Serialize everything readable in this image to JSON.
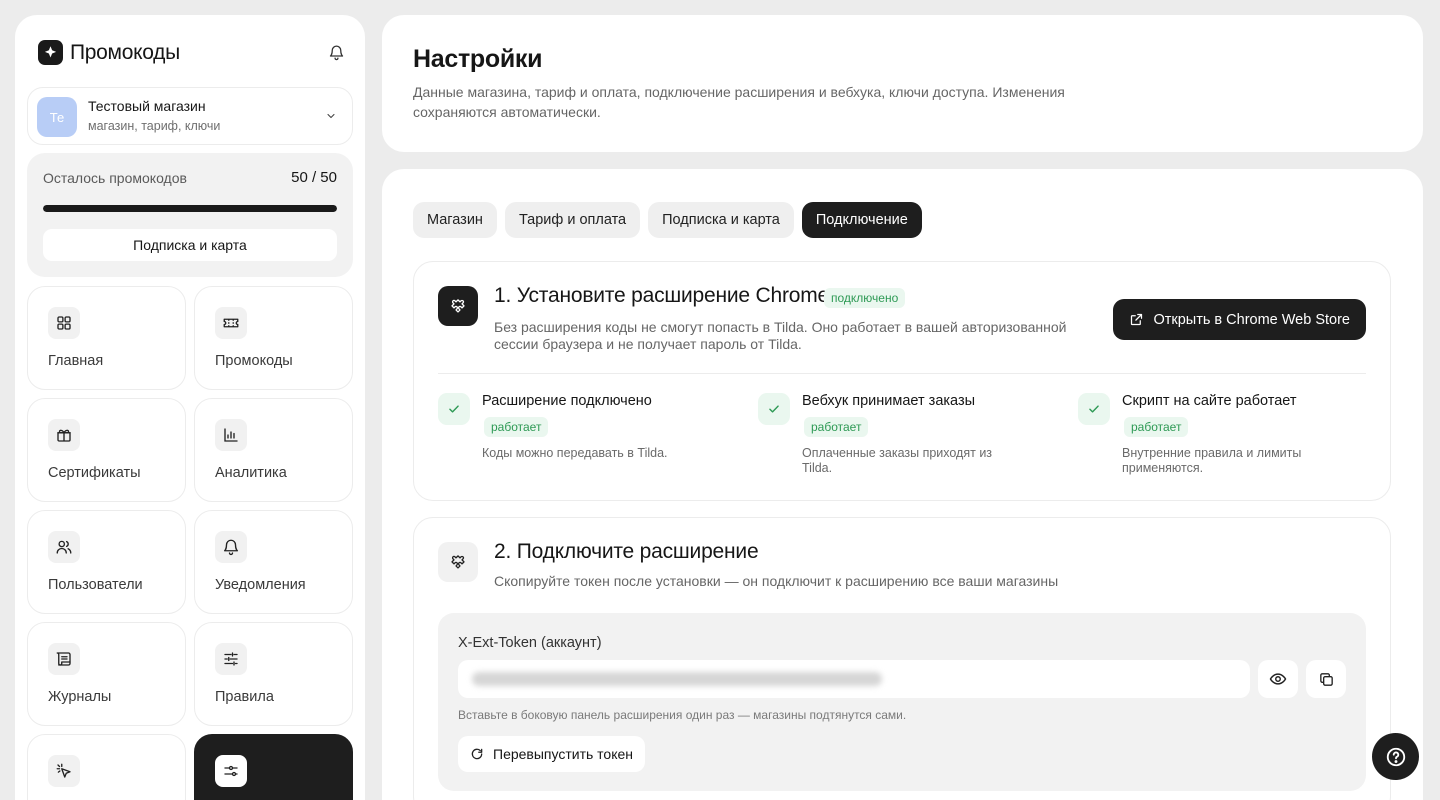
{
  "app": {
    "brand": "Промокоды"
  },
  "store": {
    "avatar": "Те",
    "name": "Тестовый магазин",
    "subtitle": "магазин, тариф, ключи"
  },
  "quota": {
    "label": "Осталось промокодов",
    "value": "50 / 50",
    "progress": 1.0,
    "button": "Подписка и карта"
  },
  "nav": [
    {
      "label": "Главная",
      "icon": "grid-icon"
    },
    {
      "label": "Промокоды",
      "icon": "ticket-icon"
    },
    {
      "label": "Сертификаты",
      "icon": "gift-icon"
    },
    {
      "label": "Аналитика",
      "icon": "bar-chart-icon"
    },
    {
      "label": "Пользователи",
      "icon": "users-icon"
    },
    {
      "label": "Уведомления",
      "icon": "bell-icon"
    },
    {
      "label": "Журналы",
      "icon": "scroll-icon"
    },
    {
      "label": "Правила",
      "icon": "sliders-icon"
    },
    {
      "label": "",
      "icon": "sparkle-icon"
    },
    {
      "label": "",
      "icon": "settings-sliders-icon",
      "active": true
    }
  ],
  "header": {
    "title": "Настройки",
    "description": "Данные магазина, тариф и оплата, подключение расширения и вебхука, ключи доступа. Изменения сохраняются автоматически."
  },
  "tabs": [
    {
      "label": "Магазин",
      "active": false
    },
    {
      "label": "Тариф и оплата",
      "active": false
    },
    {
      "label": "Подписка и карта",
      "active": false
    },
    {
      "label": "Подключение",
      "active": true
    }
  ],
  "step1": {
    "title": "1. Установите расширение Chrome",
    "badge": "подключено",
    "description": "Без расширения коды не смогут попасть в Tilda. Оно работает в вашей авторизованной сессии браузера и не получает пароль от Tilda.",
    "button": "Открыть в Chrome Web Store",
    "checks": [
      {
        "title": "Расширение подключено",
        "badge": "работает",
        "note": "Коды можно передавать в Tilda."
      },
      {
        "title": "Вебхук принимает заказы",
        "badge": "работает",
        "note": "Оплаченные заказы приходят из Tilda."
      },
      {
        "title": "Скрипт на сайте работает",
        "badge": "работает",
        "note": "Внутренние правила и лимиты применяются."
      }
    ]
  },
  "step2": {
    "title": "2. Подключите расширение",
    "description": "Скопируйте токен после установки — он подключит к расширению все ваши магазины",
    "token_label": "X-Ext-Token (аккаунт)",
    "hint": "Вставьте в боковую панель расширения один раз — магазины подтянутся сами.",
    "reissue": "Перевыпустить токен"
  },
  "colors": {
    "accent": "#1e1e1e",
    "success": "#2e9a55",
    "success_bg": "#eaf7ef",
    "avatar": "#b8cdf6"
  }
}
